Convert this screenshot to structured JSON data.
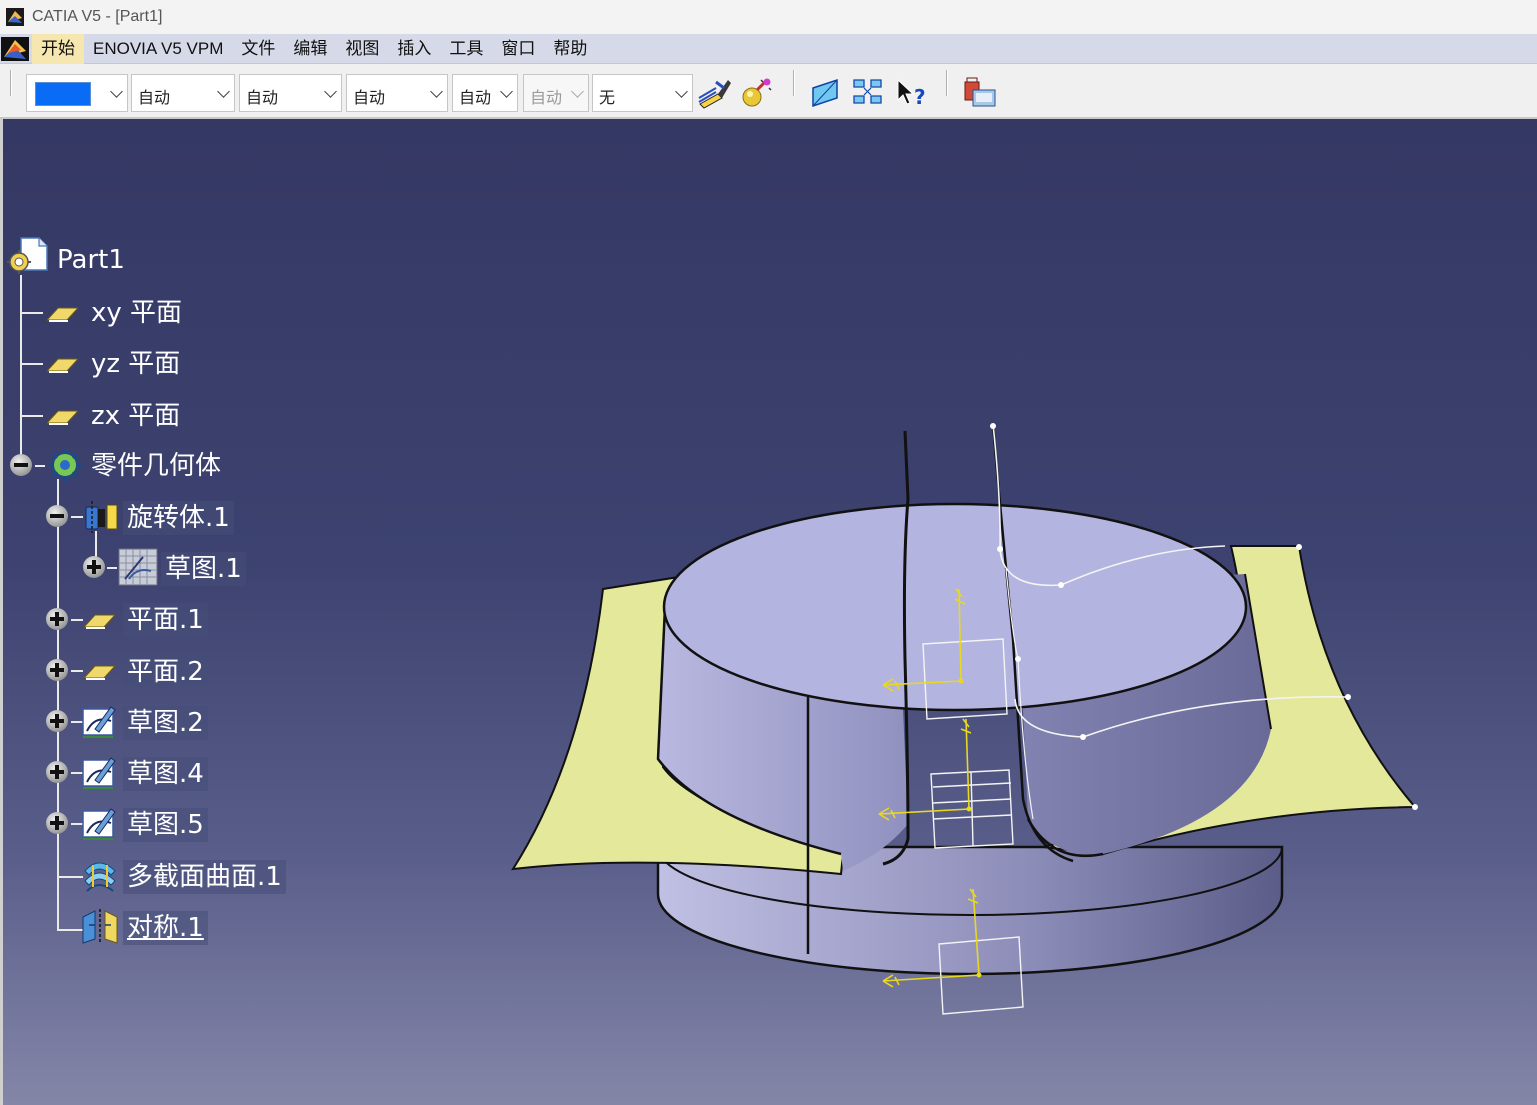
{
  "window": {
    "title": "CATIA V5 - [Part1]"
  },
  "menu": {
    "items": [
      "开始",
      "ENOVIA V5 VPM",
      "文件",
      "编辑",
      "视图",
      "插入",
      "工具",
      "窗口",
      "帮助"
    ],
    "active_index": 0
  },
  "toolbar": {
    "color_value": "#0a6cf5",
    "combos": [
      {
        "value": "自动"
      },
      {
        "value": "自动"
      },
      {
        "value": "自动"
      },
      {
        "value": "自动"
      },
      {
        "value": "自动",
        "disabled": true
      },
      {
        "value": "无"
      }
    ],
    "icons": [
      "painter-icon",
      "material-icon",
      "plane-icon",
      "grid-icon",
      "whats-this-icon",
      "catalog-icon"
    ]
  },
  "tree": {
    "root": "Part1",
    "planes": [
      "xy 平面",
      "yz 平面",
      "zx 平面"
    ],
    "body": "零件几何体",
    "body_children": [
      "旋转体.1",
      "草图.1"
    ],
    "items": [
      "平面.1",
      "平面.2",
      "草图.2",
      "草图.4",
      "草图.5",
      "多截面曲面.1",
      "对称.1"
    ]
  }
}
